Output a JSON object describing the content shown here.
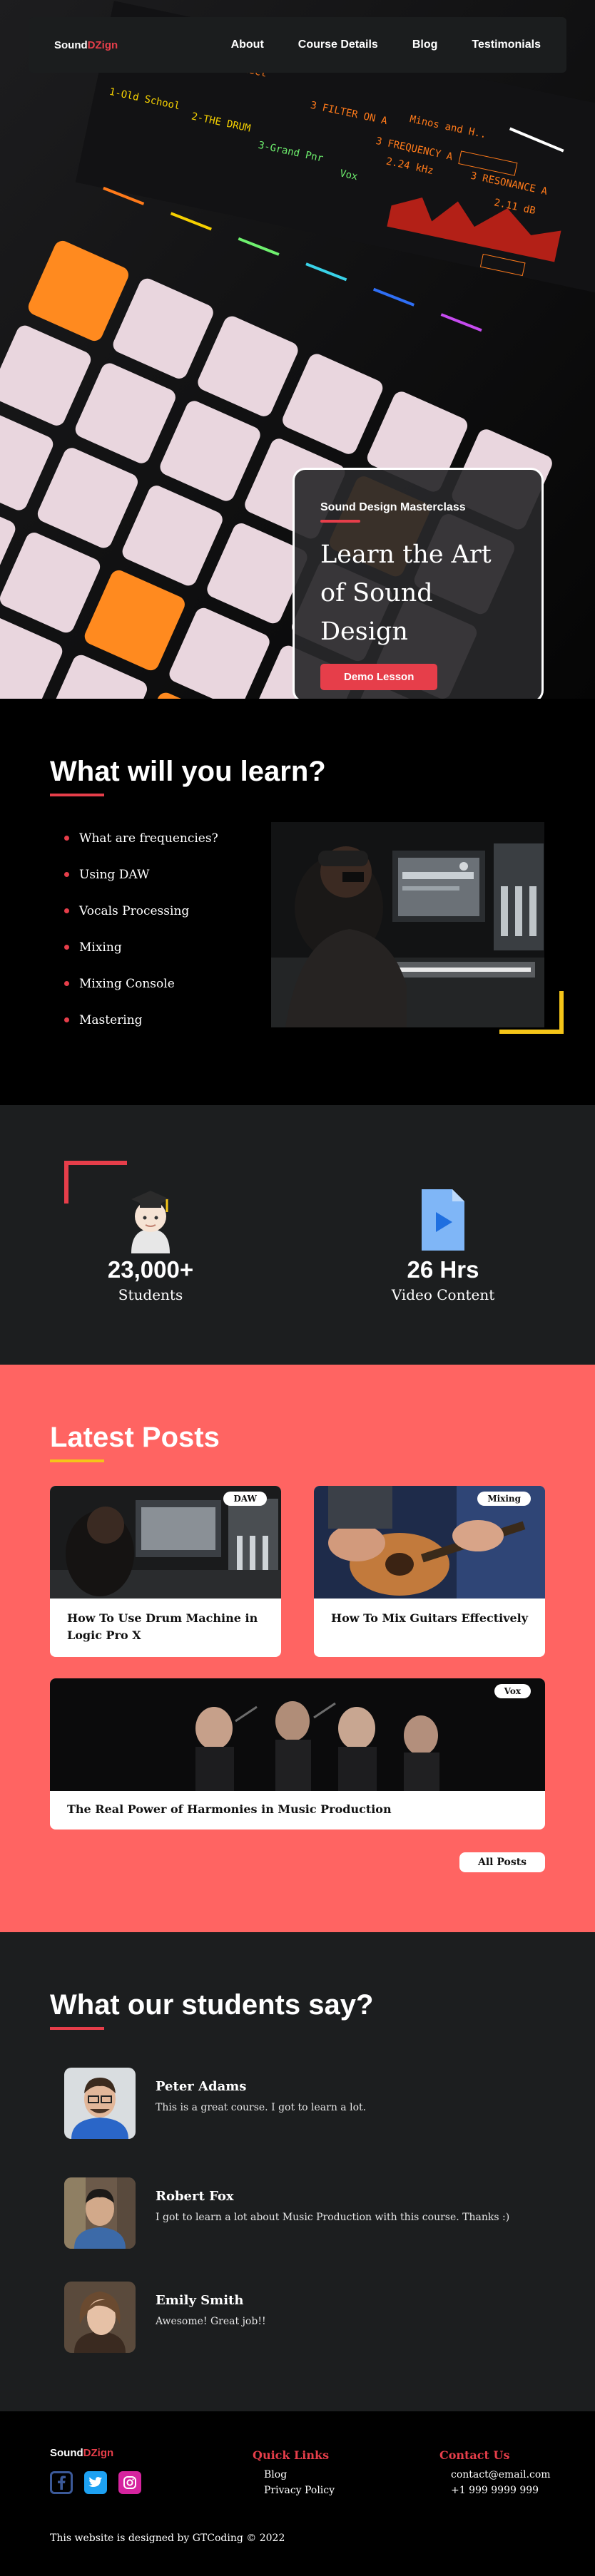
{
  "brand": {
    "name_part1": "Sound",
    "name_part2": "DZign"
  },
  "nav": {
    "links": [
      "About",
      "Course Details",
      "Blog",
      "Testimonials"
    ]
  },
  "hero": {
    "eyebrow": "Sound Design Masterclass",
    "title": "Learn the Art of Sound Design",
    "cta": "Demo Lesson"
  },
  "learn": {
    "heading": "What will you learn?",
    "items": [
      "What are frequencies?",
      "Using DAW",
      "Vocals Processing",
      "Mixing",
      "Mixing Console",
      "Mastering"
    ]
  },
  "stats": [
    {
      "value": "23,000+",
      "label": "Students",
      "icon": "student-emoji-icon"
    },
    {
      "value": "26 Hrs",
      "label": "Video Content",
      "icon": "video-file-icon"
    }
  ],
  "posts": {
    "heading": "Latest Posts",
    "items": [
      {
        "tag": "DAW",
        "title": "How To Use Drum Machine in Logic Pro X"
      },
      {
        "tag": "Mixing",
        "title": "How To Mix Guitars Effectively"
      },
      {
        "tag": "Vox",
        "title": "The Real Power of Harmonies in Music Production"
      }
    ],
    "all_label": "All Posts"
  },
  "testimonials": {
    "heading": "What our students say?",
    "items": [
      {
        "name": "Peter Adams",
        "quote": "This is a great course. I got to learn a lot."
      },
      {
        "name": "Robert Fox",
        "quote": "I got to learn a lot about Music Production with this course. Thanks :)"
      },
      {
        "name": "Emily Smith",
        "quote": "Awesome! Great job!!"
      }
    ]
  },
  "footer": {
    "quick_links_heading": "Quick Links",
    "quick_links": [
      "Blog",
      "Privacy Policy"
    ],
    "contact_heading": "Contact Us",
    "contact": [
      "contact@email.com",
      "+1 999 9999 999"
    ],
    "credit": "This website is designed by GTCoding © 2022",
    "social": [
      "facebook-icon",
      "twitter-icon",
      "instagram-icon"
    ]
  },
  "colors": {
    "accent": "#e63e4a",
    "posts_bg": "#ff6462",
    "highlight": "#f5c518",
    "dark": "#1c1e1f"
  }
}
